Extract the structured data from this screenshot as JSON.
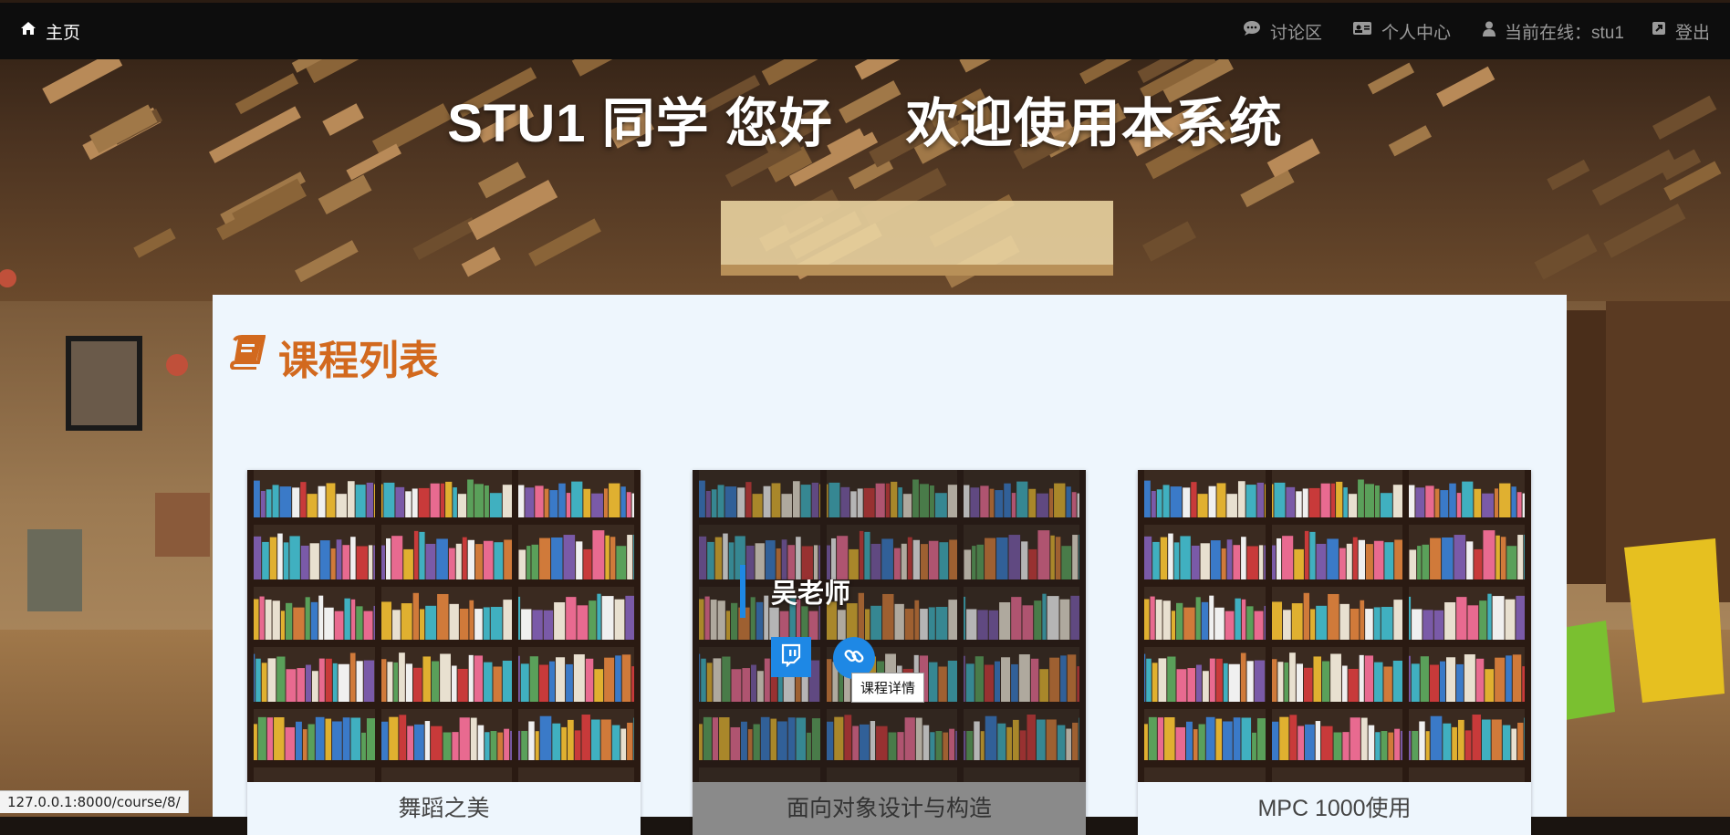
{
  "nav": {
    "home": {
      "label": "主页",
      "icon": "home-icon"
    },
    "forum": {
      "label": "讨论区",
      "icon": "comment-icon"
    },
    "profile": {
      "label": "个人中心",
      "icon": "id-card-icon"
    },
    "online": {
      "label": "当前在线：stu1",
      "icon": "user-icon"
    },
    "logout": {
      "label": "登出",
      "icon": "external-link-icon"
    }
  },
  "hero": {
    "greeting": "STU1 同学 您好",
    "welcome": "欢迎使用本系统"
  },
  "course_list": {
    "title": "课程列表",
    "icon": "book-icon",
    "title_color": "#d2691e",
    "courses": [
      {
        "name": "舞蹈之美"
      },
      {
        "name": "面向对象设计与构造",
        "teacher": "吴老师",
        "tooltip": "课程详情",
        "hovered": true
      },
      {
        "name": "MPC 1000使用"
      }
    ]
  },
  "status_bar": {
    "url": "127.0.0.1:8000/course/8/"
  },
  "colors": {
    "accent": "#1e88e5",
    "nav_bg": "#0d0d0d",
    "panel_bg": "#eef6fd"
  }
}
